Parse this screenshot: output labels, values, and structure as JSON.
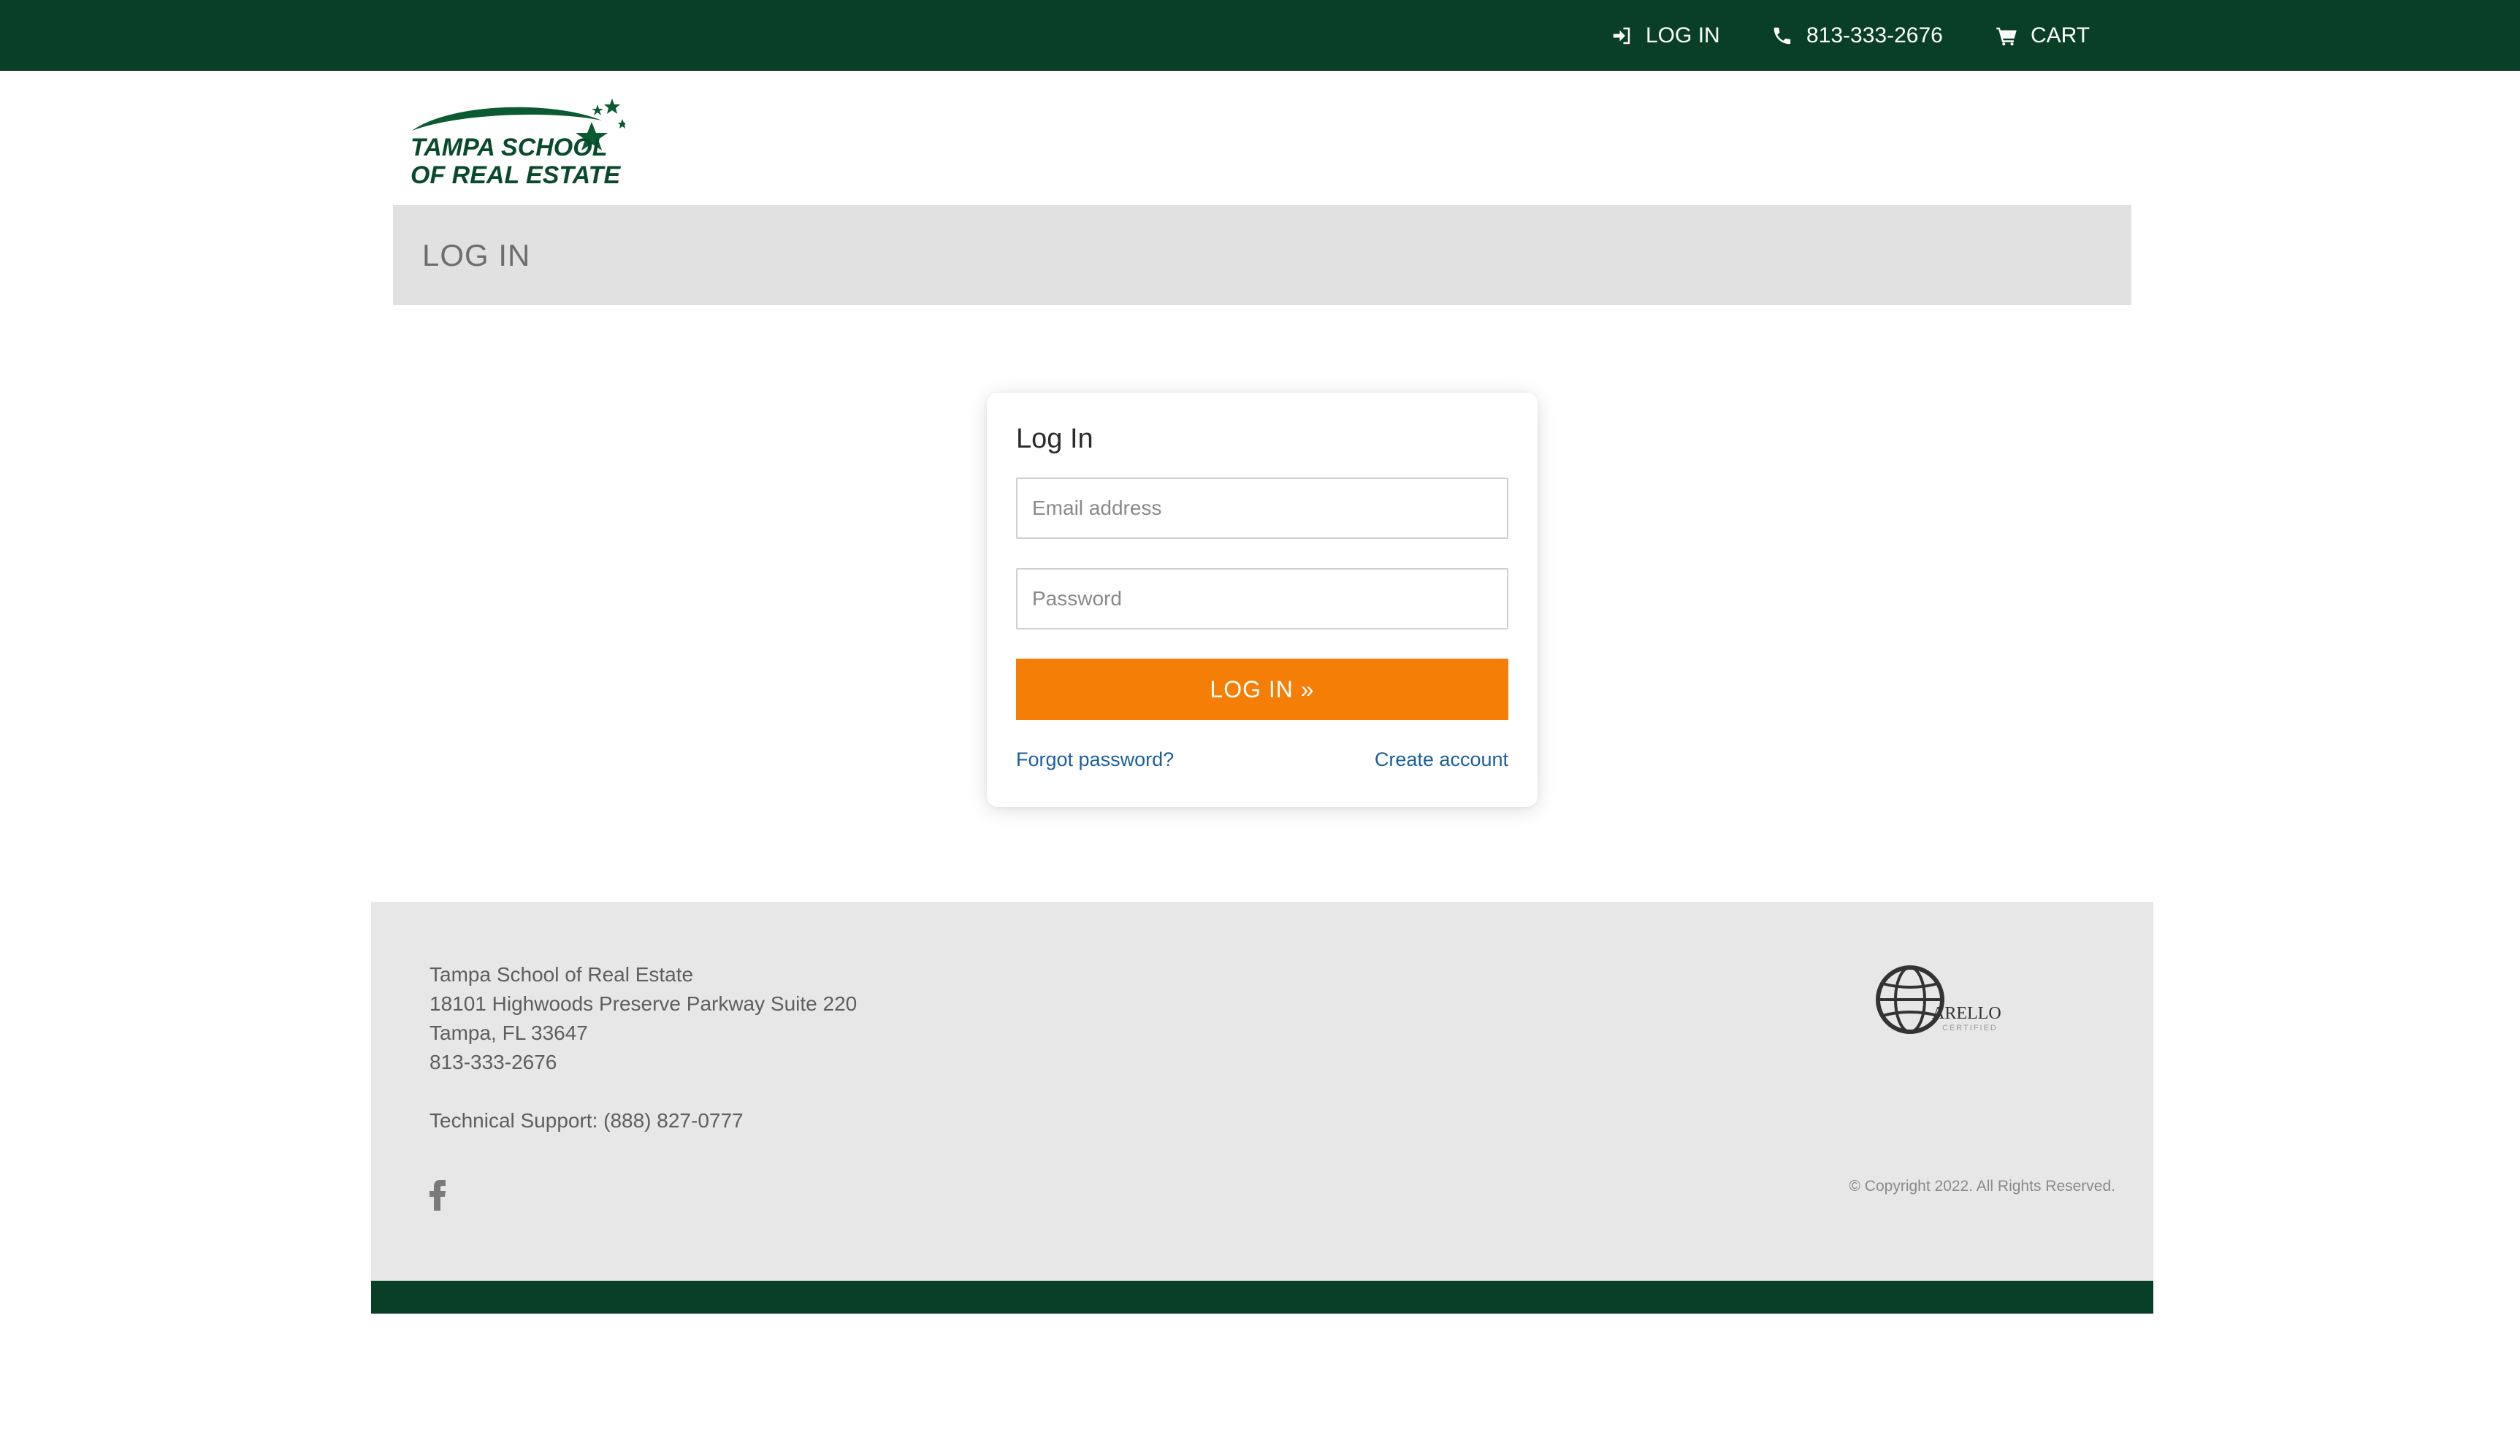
{
  "topbar": {
    "login_label": "LOG IN",
    "phone_label": "813-333-2676",
    "cart_label": "CART"
  },
  "logo": {
    "line1": "TAMPA SCHOOL",
    "line2": "OF REAL ESTATE"
  },
  "page": {
    "title": "LOG IN"
  },
  "login_form": {
    "heading": "Log In",
    "email_placeholder": "Email address",
    "password_placeholder": "Password",
    "submit_label": "LOG IN »",
    "forgot_label": "Forgot password?",
    "create_label": "Create account"
  },
  "footer": {
    "company": "Tampa School of Real Estate",
    "street": "18101 Highwoods Preserve Parkway Suite 220",
    "city": "Tampa, FL 33647",
    "phone": "813-333-2676",
    "support": "Technical Support: (888) 827-0777",
    "copyright": "© Copyright 2022. All Rights Reserved.",
    "badge_text": "ARELLO",
    "badge_sub": "CERTIFIED"
  },
  "colors": {
    "brand_green": "#0a3f27",
    "accent_orange": "#f57f06",
    "link_blue": "#1a5f9e"
  }
}
